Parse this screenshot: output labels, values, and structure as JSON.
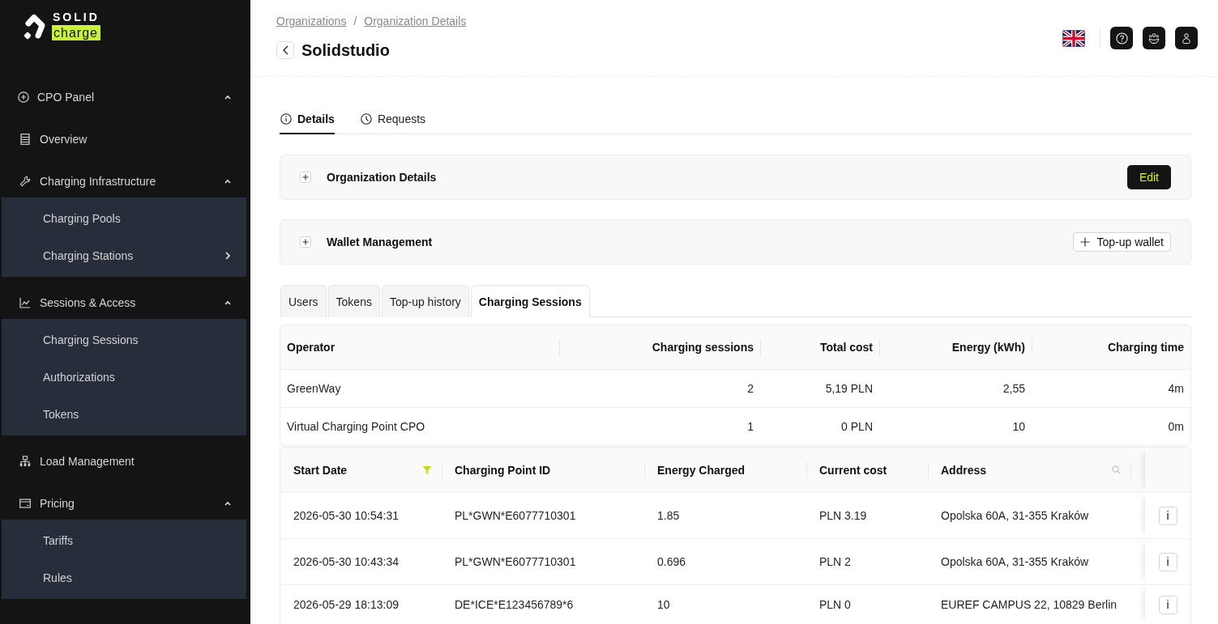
{
  "sidebar": {
    "logo": {
      "wordmark": "SOLID",
      "tag": "charge"
    },
    "panel": {
      "label": "CPO Panel",
      "expanded": true
    },
    "items": [
      {
        "kind": "link",
        "label": "Overview"
      },
      {
        "kind": "group",
        "label": "Charging Infrastructure",
        "expanded": true,
        "children": [
          {
            "label": "Charging Pools",
            "submenu": false
          },
          {
            "label": "Charging Stations",
            "submenu": true
          }
        ]
      },
      {
        "kind": "group",
        "label": "Sessions & Access",
        "expanded": true,
        "children": [
          {
            "label": "Charging Sessions",
            "submenu": false
          },
          {
            "label": "Authorizations",
            "submenu": false
          },
          {
            "label": "Tokens",
            "submenu": false
          }
        ]
      },
      {
        "kind": "link",
        "label": "Load Management"
      },
      {
        "kind": "group",
        "label": "Pricing",
        "expanded": true,
        "children": [
          {
            "label": "Tariffs",
            "submenu": false
          },
          {
            "label": "Rules",
            "submenu": false
          }
        ]
      }
    ]
  },
  "header": {
    "breadcrumbs": [
      "Organizations",
      "Organization Details"
    ],
    "breadcrumb_separator": "/",
    "title": "Solidstudio"
  },
  "tabs": [
    {
      "label": "Details",
      "selected": true
    },
    {
      "label": "Requests",
      "selected": false
    }
  ],
  "panels": [
    {
      "title": "Organization Details",
      "expanded": false,
      "action": {
        "kind": "primary",
        "label": "Edit"
      }
    },
    {
      "title": "Wallet Management",
      "expanded": false,
      "action": {
        "kind": "add",
        "label": "Top-up wallet"
      }
    }
  ],
  "subtabs": [
    {
      "label": "Users",
      "selected": false
    },
    {
      "label": "Tokens",
      "selected": false
    },
    {
      "label": "Top-up history",
      "selected": false
    },
    {
      "label": "Charging Sessions",
      "selected": true
    }
  ],
  "summary_table": {
    "columns": [
      "Operator",
      "Charging sessions",
      "Total cost",
      "Energy (kWh)",
      "Charging time"
    ],
    "rows": [
      [
        "GreenWay",
        "2",
        "5,19 PLN",
        "2,55",
        "4m"
      ],
      [
        "Virtual Charging Point CPO",
        "1",
        "0 PLN",
        "10",
        "0m"
      ]
    ]
  },
  "sessions_table": {
    "columns": [
      {
        "label": "Start Date",
        "filtered": true,
        "searchable": false
      },
      {
        "label": "Charging Point ID",
        "filtered": false,
        "searchable": false
      },
      {
        "label": "Energy Charged",
        "filtered": false,
        "searchable": false
      },
      {
        "label": "Current cost",
        "filtered": false,
        "searchable": false
      },
      {
        "label": "Address",
        "filtered": false,
        "searchable": true
      }
    ],
    "rows": [
      {
        "cells": [
          "2026-05-30 10:54:31",
          "PL*GWN*E6077710301",
          "1.85",
          "PLN 3.19",
          "Opolska 60A, 31-355 Kraków"
        ],
        "action": "i"
      },
      {
        "cells": [
          "2026-05-30 10:43:34",
          "PL*GWN*E6077710301",
          "0.696",
          "PLN 2",
          "Opolska 60A, 31-355 Kraków"
        ],
        "action": "i"
      },
      {
        "cells": [
          "2026-05-29 18:13:09",
          "DE*ICE*E123456789*6",
          "10",
          "PLN 0",
          "EUREF CAMPUS 22, 10829 Berlin"
        ],
        "action": "i"
      }
    ]
  }
}
